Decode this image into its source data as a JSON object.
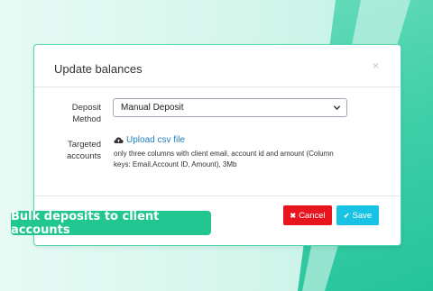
{
  "dialog": {
    "title": "Update balances",
    "close_glyph": "×",
    "deposit_method": {
      "label_line1": "Deposit",
      "label_line2": "Method",
      "selected_value": "Manual Deposit"
    },
    "targeted_accounts": {
      "label_line1": "Targeted",
      "label_line2": "accounts",
      "upload_link": "Upload csv file",
      "help_text": "only three columns with client email, account id and amount (Column keys: Email,Account ID, Amount), 3Mb"
    },
    "buttons": {
      "cancel_label": "Cancel",
      "save_label": "Save"
    }
  },
  "callout": {
    "text": "Bulk deposits to client accounts"
  },
  "colors": {
    "accent_green": "#22c690",
    "cancel_red": "#e8141e",
    "save_cyan": "#17c2e3",
    "link_blue": "#1f7fc0"
  },
  "icons": [
    "close-icon",
    "chevron-down-icon",
    "cloud-upload-icon",
    "times-icon",
    "check-icon"
  ]
}
